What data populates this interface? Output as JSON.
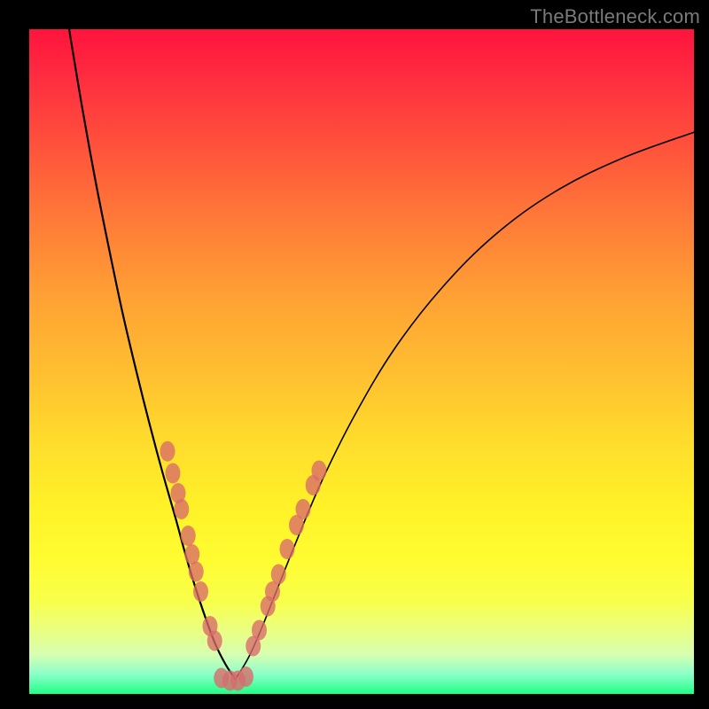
{
  "watermark": "TheBottleneck.com",
  "colors": {
    "background": "#000000",
    "curve": "#000000",
    "marker": "#d86a6a"
  },
  "chart_data": {
    "type": "line",
    "title": "",
    "xlabel": "",
    "ylabel": "",
    "xlim": [
      0,
      100
    ],
    "ylim": [
      0,
      100
    ],
    "note": "No axis ticks or labels are rendered. X/Y are percentage positions within the plot area (0..100). Y=0 is top (worst/red), Y=100 is bottom (best/green). The two curves form a V shape with minimum near x≈27.",
    "series": [
      {
        "name": "left-curve",
        "x": [
          6,
          8,
          10,
          12,
          14,
          16,
          18,
          20,
          22,
          23.5,
          25,
          26.5,
          28,
          29.5,
          31
        ],
        "y": [
          0,
          12,
          23,
          33,
          42.5,
          51,
          59,
          66.5,
          73.5,
          79,
          84,
          88.5,
          92.5,
          95.5,
          97.8
        ]
      },
      {
        "name": "right-curve",
        "x": [
          31,
          33,
          35,
          37,
          40,
          44,
          49,
          55,
          62,
          70,
          79,
          89,
          100
        ],
        "y": [
          97.8,
          94.5,
          90,
          85,
          77.5,
          68,
          58,
          48,
          39,
          31,
          24.5,
          19.5,
          15.5
        ]
      }
    ],
    "markers": {
      "note": "Pink oval markers clustered around the V bottom on both curves.",
      "points": [
        {
          "x": 20.8,
          "y": 63.5,
          "side": "left"
        },
        {
          "x": 21.6,
          "y": 66.8,
          "side": "left"
        },
        {
          "x": 22.4,
          "y": 69.8,
          "side": "left"
        },
        {
          "x": 22.9,
          "y": 72.2,
          "side": "left"
        },
        {
          "x": 23.9,
          "y": 76.2,
          "side": "left"
        },
        {
          "x": 24.5,
          "y": 79.0,
          "side": "left"
        },
        {
          "x": 25.1,
          "y": 81.6,
          "side": "left"
        },
        {
          "x": 25.8,
          "y": 84.6,
          "side": "left"
        },
        {
          "x": 27.2,
          "y": 89.8,
          "side": "left"
        },
        {
          "x": 27.9,
          "y": 92.0,
          "side": "left"
        },
        {
          "x": 28.9,
          "y": 97.6,
          "side": "bottom"
        },
        {
          "x": 30.2,
          "y": 98.0,
          "side": "bottom"
        },
        {
          "x": 31.4,
          "y": 98.0,
          "side": "bottom"
        },
        {
          "x": 32.6,
          "y": 97.4,
          "side": "bottom"
        },
        {
          "x": 33.7,
          "y": 92.8,
          "side": "right"
        },
        {
          "x": 34.6,
          "y": 90.4,
          "side": "right"
        },
        {
          "x": 35.9,
          "y": 86.8,
          "side": "right"
        },
        {
          "x": 36.6,
          "y": 84.6,
          "side": "right"
        },
        {
          "x": 37.5,
          "y": 82.0,
          "side": "right"
        },
        {
          "x": 38.8,
          "y": 78.2,
          "side": "right"
        },
        {
          "x": 40.2,
          "y": 74.6,
          "side": "right"
        },
        {
          "x": 41.2,
          "y": 72.2,
          "side": "right"
        },
        {
          "x": 42.7,
          "y": 68.6,
          "side": "right"
        },
        {
          "x": 43.6,
          "y": 66.4,
          "side": "right"
        }
      ]
    }
  }
}
